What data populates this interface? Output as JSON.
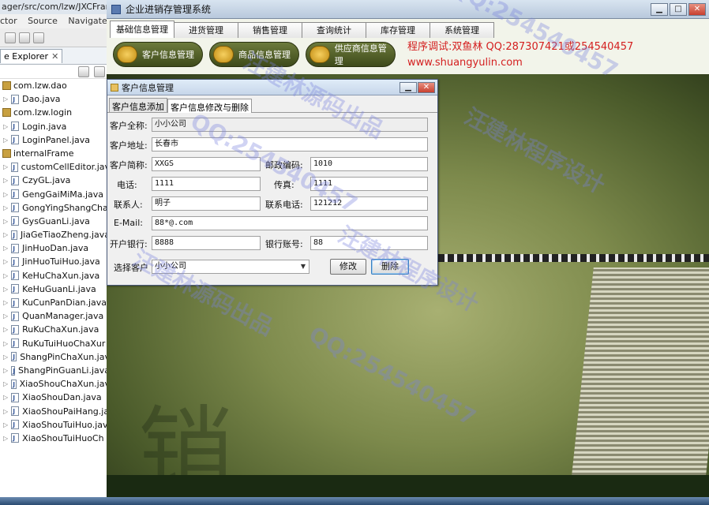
{
  "eclipse": {
    "title": "ager/src/com/lzw/JXCFran",
    "menu": [
      "ctor",
      "Source",
      "Navigate"
    ],
    "view_tab": "e Explorer",
    "view_close": "✕",
    "tree": [
      {
        "label": "com.lzw.dao",
        "kind": "pkg"
      },
      {
        "label": "Dao.java",
        "kind": "file"
      },
      {
        "label": "com.lzw.login",
        "kind": "pkg"
      },
      {
        "label": "Login.java",
        "kind": "file"
      },
      {
        "label": "LoginPanel.java",
        "kind": "file"
      },
      {
        "label": "internalFrame",
        "kind": "pkg"
      },
      {
        "label": "customCellEditor.jav",
        "kind": "file"
      },
      {
        "label": "CzyGL.java",
        "kind": "file"
      },
      {
        "label": "GengGaiMiMa.java",
        "kind": "file"
      },
      {
        "label": "GongYingShangCha",
        "kind": "file"
      },
      {
        "label": "GysGuanLi.java",
        "kind": "file"
      },
      {
        "label": "JiaGeTiaoZheng.java",
        "kind": "file"
      },
      {
        "label": "JinHuoDan.java",
        "kind": "file"
      },
      {
        "label": "JinHuoTuiHuo.java",
        "kind": "file"
      },
      {
        "label": "KeHuChaXun.java",
        "kind": "file"
      },
      {
        "label": "KeHuGuanLi.java",
        "kind": "file"
      },
      {
        "label": "KuCunPanDian.java",
        "kind": "file"
      },
      {
        "label": "QuanManager.java",
        "kind": "file"
      },
      {
        "label": "RuKuChaXun.java",
        "kind": "file"
      },
      {
        "label": "RuKuTuiHuoChaXur",
        "kind": "file"
      },
      {
        "label": "ShangPinChaXun.jav",
        "kind": "file"
      },
      {
        "label": "ShangPinGuanLi.java",
        "kind": "file"
      },
      {
        "label": "XiaoShouChaXun.jav",
        "kind": "file"
      },
      {
        "label": "XiaoShouDan.java",
        "kind": "file"
      },
      {
        "label": "XiaoShouPaiHang.ja",
        "kind": "file"
      },
      {
        "label": "XiaoShouTuiHuo.jav",
        "kind": "file"
      },
      {
        "label": "XiaoShouTuiHuoCh",
        "kind": "file"
      }
    ]
  },
  "app": {
    "title": "企业进销存管理系统",
    "window_buttons": {
      "minimize": "▁",
      "maximize": "□",
      "close": "✕"
    },
    "tabs": [
      "基础信息管理",
      "进货管理",
      "销售管理",
      "查询统计",
      "库存管理",
      "系统管理"
    ],
    "active_tab": "基础信息管理",
    "sub_buttons": [
      "客户信息管理",
      "商品信息管理",
      "供应商信息管理"
    ],
    "promo_line1": "程序调试:双鱼林 QQ:287307421或254540457",
    "promo_line2": "www.shuangyulin.com",
    "scene_char": "销"
  },
  "frame": {
    "title": "客户信息管理",
    "tabs": [
      "客户信息添加",
      "客户信息修改与删除"
    ],
    "active_tab": "客户信息修改与删除",
    "labels": {
      "full_name": "客户全称:",
      "address": "客户地址:",
      "short_name": "客户简称:",
      "postcode": "邮政编码:",
      "phone": "电话:",
      "fax": "传真:",
      "contact": "联系人:",
      "contact_phone": "联系电话:",
      "email": "E-Mail:",
      "bank": "开户银行:",
      "account": "银行账号:",
      "select_customer": "选择客户"
    },
    "values": {
      "full_name": "小小公司",
      "address": "长春市",
      "short_name": "XXGS",
      "postcode": "1010",
      "phone": "1111",
      "fax": "1111",
      "contact": "明子",
      "contact_phone": "121212",
      "email": "88*@.com",
      "bank": "8888",
      "account": "88",
      "select_customer": "小小公司"
    },
    "buttons": {
      "modify": "修改",
      "delete": "删除"
    }
  },
  "watermarks": [
    "QQ:254540457",
    "汪建林程序设计",
    "汪建林源码出品"
  ]
}
